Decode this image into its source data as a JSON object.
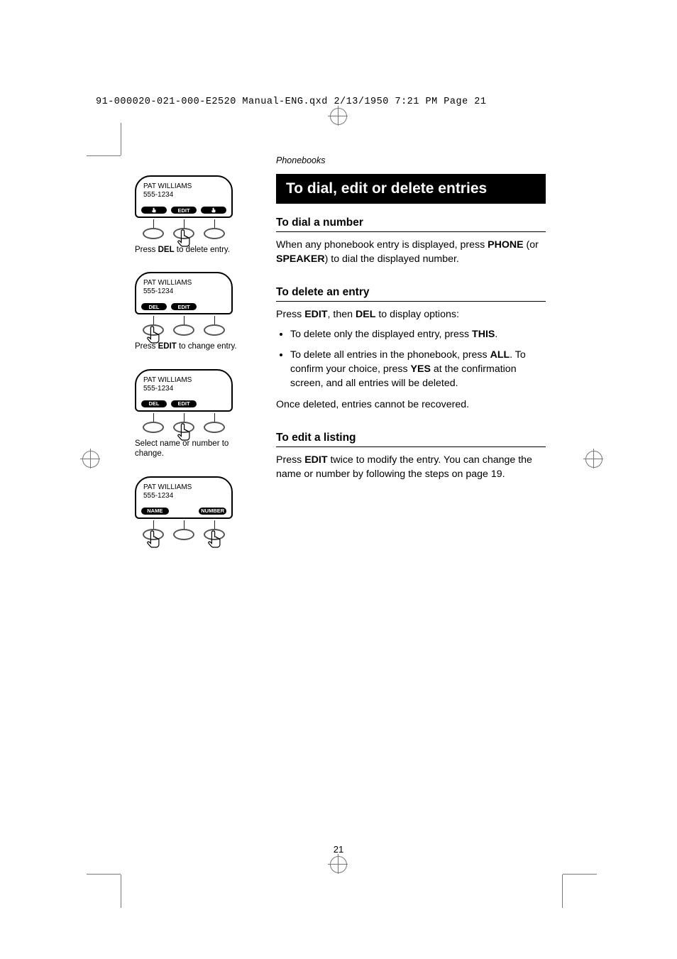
{
  "header_line": "91-000020-021-000-E2520 Manual-ENG.qxd  2/13/1950  7:21 PM  Page 21",
  "left_col": {
    "screen_name": "PAT WILLIAMS",
    "screen_number": "555-1234",
    "mod1": {
      "softkeys": [
        "",
        "EDIT",
        ""
      ],
      "caption_pre": "Press ",
      "caption_key": "DEL",
      "caption_post": " to delete entry."
    },
    "mod2": {
      "softkeys": [
        "DEL",
        "EDIT",
        ""
      ],
      "caption_pre": "Press ",
      "caption_key": "DEL",
      "caption_post": " to delete entry."
    },
    "mod3": {
      "softkeys": [
        "DEL",
        "EDIT",
        ""
      ],
      "caption_pre": "Press ",
      "caption_key": "EDIT",
      "caption_post": " to change entry."
    },
    "mod4": {
      "softkeys": [
        "NAME",
        "",
        "NUMBER"
      ],
      "caption": "Select name or number to change."
    }
  },
  "right_col": {
    "breadcrumb": "Phonebooks",
    "title": "To dial, edit or delete entries",
    "sec1": {
      "heading": "To dial a number",
      "p1_a": "When any phonebook entry is displayed, press ",
      "p1_key1": "PHONE",
      "p1_b": " (or ",
      "p1_key2": "SPEAKER",
      "p1_c": ") to dial the displayed number."
    },
    "sec2": {
      "heading": "To delete an entry",
      "p1_a": "Press ",
      "p1_key1": "EDIT",
      "p1_b": ", then ",
      "p1_key2": "DEL",
      "p1_c": " to display options:",
      "li1_a": "To delete only the displayed entry, press ",
      "li1_key": "THIS",
      "li1_b": ".",
      "li2_a": "To delete all entries in the phonebook, press ",
      "li2_key1": "ALL",
      "li2_b": ". To confirm your choice, press ",
      "li2_key2": "YES",
      "li2_c": " at the confirma­tion screen, and all entries will be deleted.",
      "p2": "Once deleted, entries cannot be recovered."
    },
    "sec3": {
      "heading": "To edit a listing",
      "p1_a": "Press ",
      "p1_key": "EDIT",
      "p1_b": " twice to modify the entry. You can change the name or number by following the steps on page 19."
    }
  },
  "page_number": "21"
}
